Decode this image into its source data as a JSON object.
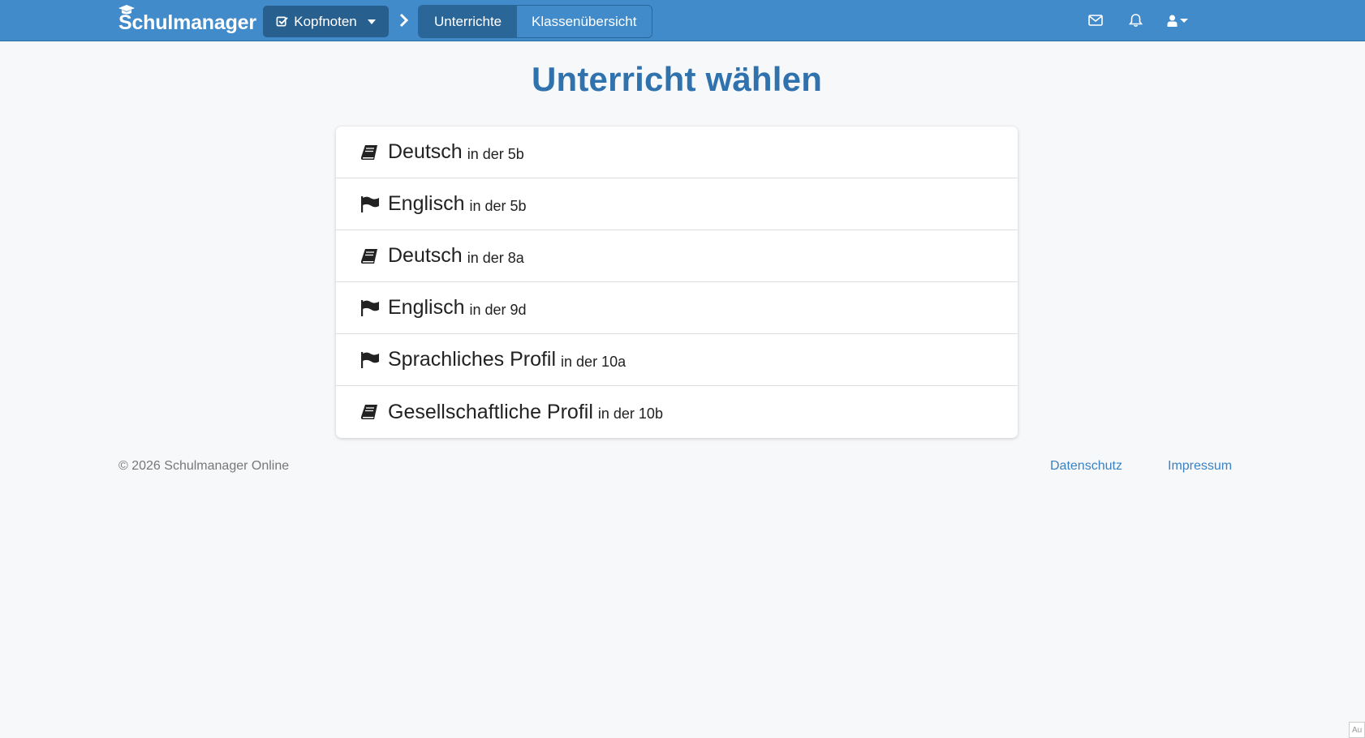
{
  "brand": {
    "name": "Schulmanager",
    "icon": "graduation-cap-icon"
  },
  "nav": {
    "module_button": {
      "icon": "check-square-icon",
      "label": "Kopfnoten"
    },
    "segments": [
      {
        "label": "Unterrichte",
        "active": true
      },
      {
        "label": "Klassenübersicht",
        "active": false
      }
    ],
    "icons": [
      "envelope-icon",
      "bell-icon",
      "user-icon"
    ]
  },
  "page": {
    "title": "Unterricht wählen"
  },
  "lessons": [
    {
      "subject": "Deutsch",
      "class_text": "in der 5b",
      "icon": "book-icon"
    },
    {
      "subject": "Englisch",
      "class_text": "in der 5b",
      "icon": "flag-icon"
    },
    {
      "subject": "Deutsch",
      "class_text": "in der 8a",
      "icon": "book-icon"
    },
    {
      "subject": "Englisch",
      "class_text": "in der 9d",
      "icon": "flag-icon"
    },
    {
      "subject": "Sprachliches Profil",
      "class_text": "in der 10a",
      "icon": "flag-icon"
    },
    {
      "subject": "Gesellschaftliche Profil",
      "class_text": "in der 10b",
      "icon": "book-icon"
    }
  ],
  "footer": {
    "copyright": "© 2026 Schulmanager Online",
    "links": [
      "Datenschutz",
      "Impressum"
    ]
  },
  "corner_tag": "Au",
  "colors": {
    "navbar": "#418bca",
    "title": "#2f72ad",
    "link": "#3a82c4"
  }
}
